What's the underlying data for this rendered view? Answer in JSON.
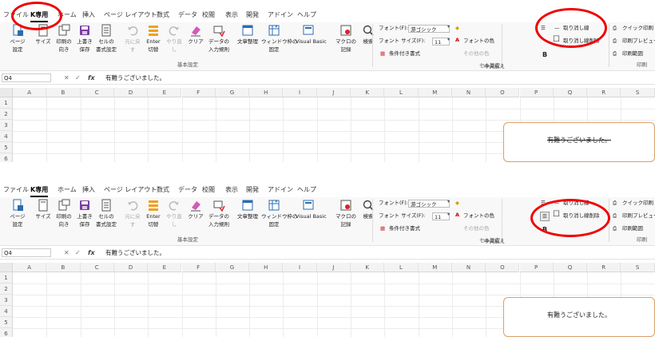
{
  "panels": [
    {
      "tabs": [
        "ファイル",
        "K専用",
        "ホーム",
        "挿入",
        "ページ レイアウト",
        "数式",
        "データ",
        "校閲",
        "表示",
        "開発",
        "アドイン",
        "ヘルプ"
      ],
      "active_tab": 1,
      "ribbon": {
        "buttons": [
          {
            "label1": "ページ",
            "label2": "設定",
            "icon": "page-setup-icon"
          },
          {
            "label1": "サイズ",
            "label2": "",
            "icon": "size-icon"
          },
          {
            "label1": "印刷の",
            "label2": "向き",
            "icon": "orientation-icon"
          },
          {
            "label1": "上書き",
            "label2": "保存",
            "icon": "save-icon"
          },
          {
            "label1": "セルの",
            "label2": "書式設定",
            "icon": "format-cells-icon"
          },
          {
            "label1": "元に戻",
            "label2": "す",
            "icon": "undo-icon",
            "disabled": true
          },
          {
            "label1": "Enter",
            "label2": "切替",
            "icon": "enter-toggle-icon"
          },
          {
            "label1": "やり直",
            "label2": "し",
            "icon": "redo-icon",
            "disabled": true
          },
          {
            "label1": "クリア",
            "label2": "",
            "icon": "eraser-icon"
          },
          {
            "label1": "データの",
            "label2": "入力規則",
            "icon": "data-validation-icon"
          },
          {
            "label1": "文章整理",
            "label2": "",
            "icon": "text-tidy-icon"
          },
          {
            "label1": "ウィンドウ枠の",
            "label2": "固定",
            "icon": "freeze-panes-icon"
          },
          {
            "label1": "Visual Basic",
            "label2": "",
            "icon": "visual-basic-icon"
          },
          {
            "label1": "マクロの",
            "label2": "記録",
            "icon": "macro-record-icon"
          },
          {
            "label1": "検索",
            "label2": "",
            "icon": "search-icon"
          }
        ],
        "group_basic": "基本設定",
        "font_label": "フォント(F):",
        "font_value": "游ゴシック",
        "size_label": "フォント サイズ(F):",
        "size_value": "11",
        "cond_format": "条件付き書式",
        "font_color": "フォントの色",
        "other": "その他の色",
        "center": "中央揃え",
        "group_cell": "セル設定",
        "strike_label": "取り消し線",
        "strike_remove_label": "取り消し線削除",
        "bold_label": "B",
        "quick_print": "クイック印刷",
        "print_preview": "印刷プレビュー",
        "print_range": "印刷範囲",
        "group_print": "印刷"
      },
      "formula_bar": {
        "name_box": "Q4",
        "fx": "fx",
        "formula": "有難うございました。"
      },
      "columns": [
        "A",
        "B",
        "C",
        "D",
        "E",
        "F",
        "G",
        "H",
        "I",
        "J",
        "K",
        "L",
        "M",
        "N",
        "O",
        "P",
        "Q",
        "R",
        "S"
      ],
      "rows": [
        "1",
        "2",
        "3",
        "4",
        "5",
        "6"
      ],
      "note_text": "有難うございました。",
      "note_strike": true
    },
    {
      "tabs": [
        "ファイル",
        "K専用",
        "ホーム",
        "挿入",
        "ページ レイアウト",
        "数式",
        "データ",
        "校閲",
        "表示",
        "開発",
        "アドイン",
        "ヘルプ"
      ],
      "active_tab": 1,
      "ribbon": {
        "buttons": [
          {
            "label1": "ページ",
            "label2": "設定",
            "icon": "page-setup-icon"
          },
          {
            "label1": "サイズ",
            "label2": "",
            "icon": "size-icon"
          },
          {
            "label1": "印刷の",
            "label2": "向き",
            "icon": "orientation-icon"
          },
          {
            "label1": "上書き",
            "label2": "保存",
            "icon": "save-icon"
          },
          {
            "label1": "セルの",
            "label2": "書式設定",
            "icon": "format-cells-icon"
          },
          {
            "label1": "元に戻",
            "label2": "す",
            "icon": "undo-icon",
            "disabled": true
          },
          {
            "label1": "Enter",
            "label2": "切替",
            "icon": "enter-toggle-icon"
          },
          {
            "label1": "やり直",
            "label2": "し",
            "icon": "redo-icon",
            "disabled": true
          },
          {
            "label1": "クリア",
            "label2": "",
            "icon": "eraser-icon"
          },
          {
            "label1": "データの",
            "label2": "入力規則",
            "icon": "data-validation-icon"
          },
          {
            "label1": "文章整理",
            "label2": "",
            "icon": "text-tidy-icon"
          },
          {
            "label1": "ウィンドウ枠の",
            "label2": "固定",
            "icon": "freeze-panes-icon"
          },
          {
            "label1": "Visual Basic",
            "label2": "",
            "icon": "visual-basic-icon"
          },
          {
            "label1": "マクロの",
            "label2": "記録",
            "icon": "macro-record-icon"
          },
          {
            "label1": "検索",
            "label2": "",
            "icon": "search-icon"
          }
        ],
        "group_basic": "基本設定",
        "font_label": "フォント(F):",
        "font_value": "游ゴシック",
        "size_label": "フォント サイズ(F):",
        "size_value": "11",
        "cond_format": "条件付き書式",
        "font_color": "フォントの色",
        "other": "その他の色",
        "center": "中央揃え",
        "group_cell": "セル設定",
        "strike_label": "取り消し線",
        "strike_remove_label": "取り消し線削除",
        "bold_label": "B",
        "quick_print": "クイック印刷",
        "print_preview": "印刷プレビュー",
        "print_range": "印刷範囲",
        "group_print": "印刷"
      },
      "formula_bar": {
        "name_box": "Q4",
        "fx": "fx",
        "formula": "有難うございました。"
      },
      "columns": [
        "A",
        "B",
        "C",
        "D",
        "E",
        "F",
        "G",
        "H",
        "I",
        "J",
        "K",
        "L",
        "M",
        "N",
        "O",
        "P",
        "Q",
        "R",
        "S"
      ],
      "rows": [
        "1",
        "2",
        "3",
        "4",
        "5",
        "6"
      ],
      "note_text": "有難うございました。",
      "note_strike": false
    }
  ],
  "colors": {
    "accent": "#e00000",
    "note_border": "#d9a06a",
    "ribbon_bg": "#f8f8f8"
  }
}
